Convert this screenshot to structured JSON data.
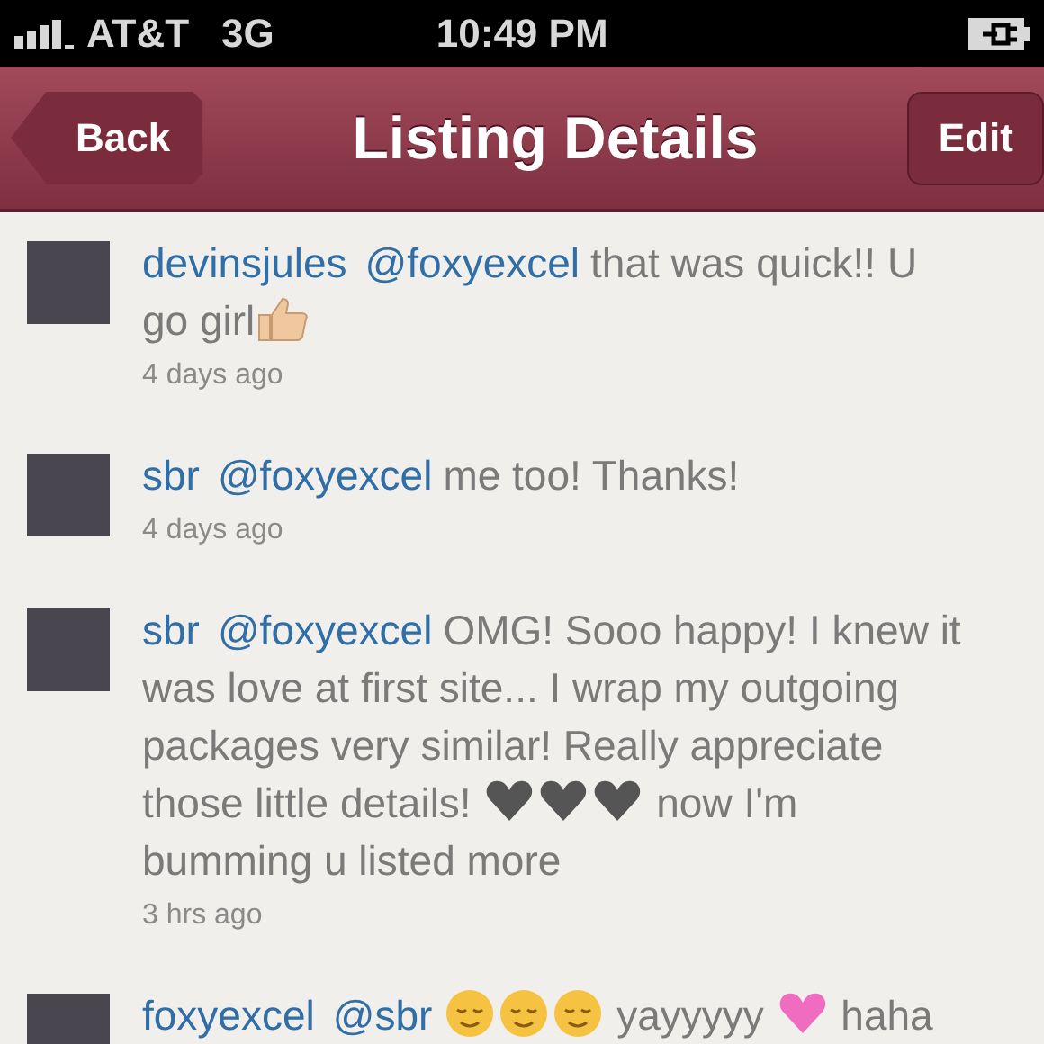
{
  "status_bar": {
    "carrier": "AT&T",
    "network": "3G",
    "time": "10:49 PM"
  },
  "nav": {
    "back": "Back",
    "title": "Listing Details",
    "edit": "Edit"
  },
  "comments": [
    {
      "user": "devinsjules",
      "mention": "@foxyexcel",
      "parts": [
        {
          "kind": "text",
          "text": "that was quick!! U go girl"
        },
        {
          "kind": "thumb"
        }
      ],
      "time": "4 days ago"
    },
    {
      "user": "sbr",
      "mention": "@foxyexcel",
      "parts": [
        {
          "kind": "text",
          "text": "me too! Thanks!"
        }
      ],
      "time": "4 days ago"
    },
    {
      "user": "sbr",
      "mention": "@foxyexcel",
      "parts": [
        {
          "kind": "text",
          "text": "OMG! Sooo happy! I knew it was love at first site... I wrap my outgoing packages very similar! Really appreciate those little details! "
        },
        {
          "kind": "heart"
        },
        {
          "kind": "heart"
        },
        {
          "kind": "heart"
        },
        {
          "kind": "text",
          "text": " now I'm bumming u listed more"
        }
      ],
      "time": "3 hrs ago"
    },
    {
      "user": "foxyexcel",
      "mention": "@sbr",
      "parts": [
        {
          "kind": "smile"
        },
        {
          "kind": "smile"
        },
        {
          "kind": "smile"
        },
        {
          "kind": "text",
          "text": " yayyyyy "
        },
        {
          "kind": "pinkheart"
        },
        {
          "kind": "text",
          "text": " haha"
        }
      ]
    }
  ]
}
